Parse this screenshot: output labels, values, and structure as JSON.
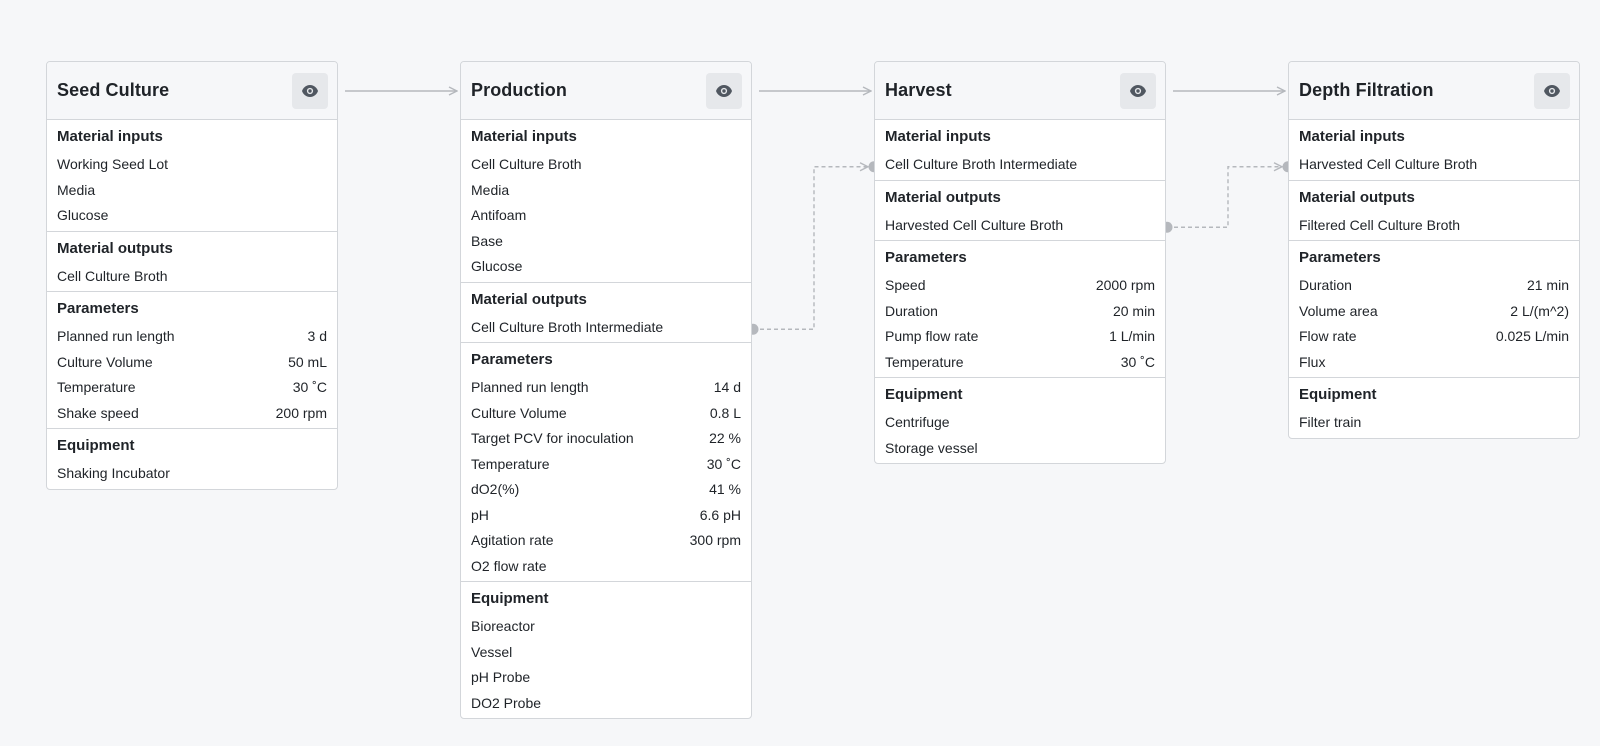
{
  "colors": {
    "background": "#f6f7f9",
    "card": "#ffffff",
    "border": "#d3d6da",
    "connector": "#b5b8bd"
  },
  "icons": {
    "card_action": "eye-icon"
  },
  "steps": [
    {
      "title": "Seed Culture",
      "sections": [
        {
          "title": "Material inputs",
          "rows": [
            {
              "label": "Working Seed Lot",
              "value": ""
            },
            {
              "label": "Media",
              "value": ""
            },
            {
              "label": "Glucose",
              "value": ""
            }
          ]
        },
        {
          "title": "Material outputs",
          "rows": [
            {
              "label": "Cell Culture Broth",
              "value": ""
            }
          ]
        },
        {
          "title": "Parameters",
          "rows": [
            {
              "label": "Planned run length",
              "value": "3 d"
            },
            {
              "label": "Culture Volume",
              "value": "50 mL"
            },
            {
              "label": "Temperature",
              "value": "30 ˚C"
            },
            {
              "label": "Shake speed",
              "value": "200 rpm"
            }
          ]
        },
        {
          "title": "Equipment",
          "rows": [
            {
              "label": "Shaking Incubator",
              "value": ""
            }
          ]
        }
      ]
    },
    {
      "title": "Production",
      "sections": [
        {
          "title": "Material inputs",
          "rows": [
            {
              "label": "Cell Culture Broth",
              "value": ""
            },
            {
              "label": "Media",
              "value": ""
            },
            {
              "label": "Antifoam",
              "value": ""
            },
            {
              "label": "Base",
              "value": ""
            },
            {
              "label": "Glucose",
              "value": ""
            }
          ]
        },
        {
          "title": "Material outputs",
          "rows": [
            {
              "label": "Cell Culture Broth Intermediate",
              "value": ""
            }
          ]
        },
        {
          "title": "Parameters",
          "rows": [
            {
              "label": "Planned run length",
              "value": "14 d"
            },
            {
              "label": "Culture Volume",
              "value": "0.8 L"
            },
            {
              "label": "Target PCV for inoculation",
              "value": "22 %"
            },
            {
              "label": "Temperature",
              "value": "30 ˚C"
            },
            {
              "label": "dO2(%)",
              "value": "41 %"
            },
            {
              "label": "pH",
              "value": "6.6 pH"
            },
            {
              "label": "Agitation rate",
              "value": "300 rpm"
            },
            {
              "label": "O2 flow rate",
              "value": ""
            }
          ]
        },
        {
          "title": "Equipment",
          "rows": [
            {
              "label": "Bioreactor",
              "value": ""
            },
            {
              "label": "Vessel",
              "value": ""
            },
            {
              "label": "pH Probe",
              "value": ""
            },
            {
              "label": "DO2 Probe",
              "value": ""
            }
          ]
        }
      ]
    },
    {
      "title": "Harvest",
      "sections": [
        {
          "title": "Material inputs",
          "rows": [
            {
              "label": "Cell Culture Broth Intermediate",
              "value": ""
            }
          ]
        },
        {
          "title": "Material outputs",
          "rows": [
            {
              "label": "Harvested Cell Culture Broth",
              "value": ""
            }
          ]
        },
        {
          "title": "Parameters",
          "rows": [
            {
              "label": "Speed",
              "value": "2000 rpm"
            },
            {
              "label": "Duration",
              "value": "20 min"
            },
            {
              "label": "Pump flow rate",
              "value": "1 L/min"
            },
            {
              "label": "Temperature",
              "value": "30 ˚C"
            }
          ]
        },
        {
          "title": "Equipment",
          "rows": [
            {
              "label": "Centrifuge",
              "value": ""
            },
            {
              "label": "Storage vessel",
              "value": ""
            }
          ]
        }
      ]
    },
    {
      "title": "Depth Filtration",
      "sections": [
        {
          "title": "Material inputs",
          "rows": [
            {
              "label": "Harvested Cell Culture Broth",
              "value": ""
            }
          ]
        },
        {
          "title": "Material outputs",
          "rows": [
            {
              "label": "Filtered Cell Culture Broth",
              "value": ""
            }
          ]
        },
        {
          "title": "Parameters",
          "rows": [
            {
              "label": "Duration",
              "value": "21 min"
            },
            {
              "label": "Volume area",
              "value": "2 L/(m^2)"
            },
            {
              "label": "Flow rate",
              "value": "0.025 L/min"
            },
            {
              "label": "Flux",
              "value": ""
            }
          ]
        },
        {
          "title": "Equipment",
          "rows": [
            {
              "label": "Filter train",
              "value": ""
            }
          ]
        }
      ]
    }
  ],
  "flow_links": [
    {
      "from_step": 0,
      "to_step": 1
    },
    {
      "from_step": 1,
      "to_step": 2
    },
    {
      "from_step": 2,
      "to_step": 3
    }
  ],
  "material_links": [
    {
      "from_step": 1,
      "to_step": 2,
      "material": "Cell Culture Broth Intermediate"
    },
    {
      "from_step": 2,
      "to_step": 3,
      "material": "Harvested Cell Culture Broth"
    }
  ]
}
